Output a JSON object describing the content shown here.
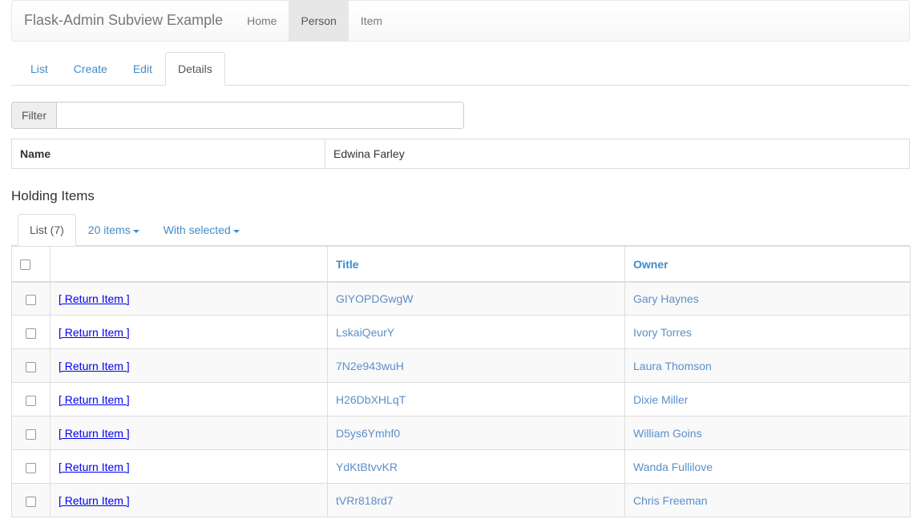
{
  "navbar": {
    "brand": "Flask-Admin Subview Example",
    "items": [
      {
        "label": "Home",
        "active": false
      },
      {
        "label": "Person",
        "active": true
      },
      {
        "label": "Item",
        "active": false
      }
    ]
  },
  "view_tabs": [
    {
      "label": "List",
      "active": false
    },
    {
      "label": "Create",
      "active": false
    },
    {
      "label": "Edit",
      "active": false
    },
    {
      "label": "Details",
      "active": true
    }
  ],
  "filter": {
    "addon_label": "Filter",
    "value": "",
    "placeholder": ""
  },
  "details": {
    "rows": [
      {
        "label": "Name",
        "value": "Edwina Farley"
      }
    ]
  },
  "holding_items": {
    "heading": "Holding Items",
    "toolbar": [
      {
        "label": "List (7)",
        "active": true,
        "caret": false
      },
      {
        "label": "20 items",
        "active": false,
        "caret": true
      },
      {
        "label": "With selected",
        "active": false,
        "caret": true
      }
    ],
    "columns": [
      "",
      "",
      "Title",
      "Owner"
    ],
    "rows": [
      {
        "action": "[ Return Item ]",
        "title": "GIYOPDGwgW",
        "owner": "Gary Haynes"
      },
      {
        "action": "[ Return Item ]",
        "title": "LskaiQeurY",
        "owner": "Ivory Torres"
      },
      {
        "action": "[ Return Item ]",
        "title": "7N2e943wuH",
        "owner": "Laura Thomson"
      },
      {
        "action": "[ Return Item ]",
        "title": "H26DbXHLqT",
        "owner": "Dixie Miller"
      },
      {
        "action": "[ Return Item ]",
        "title": "D5ys6Ymhf0",
        "owner": "William Goins"
      },
      {
        "action": "[ Return Item ]",
        "title": "YdKtBtvvKR",
        "owner": "Wanda Fullilove"
      },
      {
        "action": "[ Return Item ]",
        "title": "tVRr818rd7",
        "owner": "Chris Freeman"
      }
    ]
  },
  "colors": {
    "link": "#428bca",
    "cell_link": "#5b8fc9",
    "return_link": "#0000ee",
    "navbar_active_bg": "#e7e7e7",
    "border": "#dddddd",
    "stripe": "#f9f9f9"
  }
}
